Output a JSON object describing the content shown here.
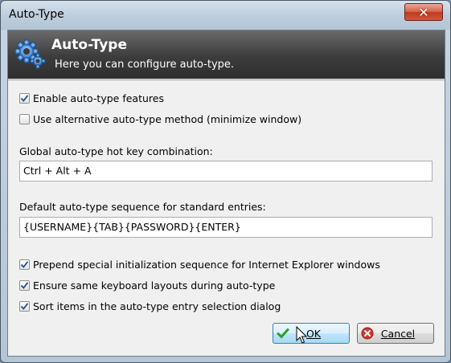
{
  "window": {
    "title": "Auto-Type",
    "close_glyph": "✕"
  },
  "banner": {
    "title": "Auto-Type",
    "subtitle": "Here you can configure auto-type.",
    "icon": "gear-icon"
  },
  "options": {
    "enable": {
      "label": "Enable auto-type features",
      "checked": true
    },
    "alternative": {
      "label": "Use alternative auto-type method (minimize window)",
      "checked": false
    }
  },
  "hotkey": {
    "label": "Global auto-type hot key combination:",
    "value": "Ctrl + Alt + A"
  },
  "sequence": {
    "label": "Default auto-type sequence for standard entries:",
    "value": "{USERNAME}{TAB}{PASSWORD}{ENTER}"
  },
  "extra_options": {
    "prepend": {
      "label": "Prepend special initialization sequence for Internet Explorer windows",
      "checked": true
    },
    "layouts": {
      "label": "Ensure same keyboard layouts during auto-type",
      "checked": true
    },
    "sort": {
      "label": "Sort items in the auto-type entry selection dialog",
      "checked": true
    }
  },
  "buttons": {
    "ok": "OK",
    "cancel": "Cancel"
  },
  "colors": {
    "banner_bg": "#3c3c3c",
    "ok_border": "#3c7fb1",
    "check": "#1f4f8f",
    "close": "#c0391f"
  }
}
